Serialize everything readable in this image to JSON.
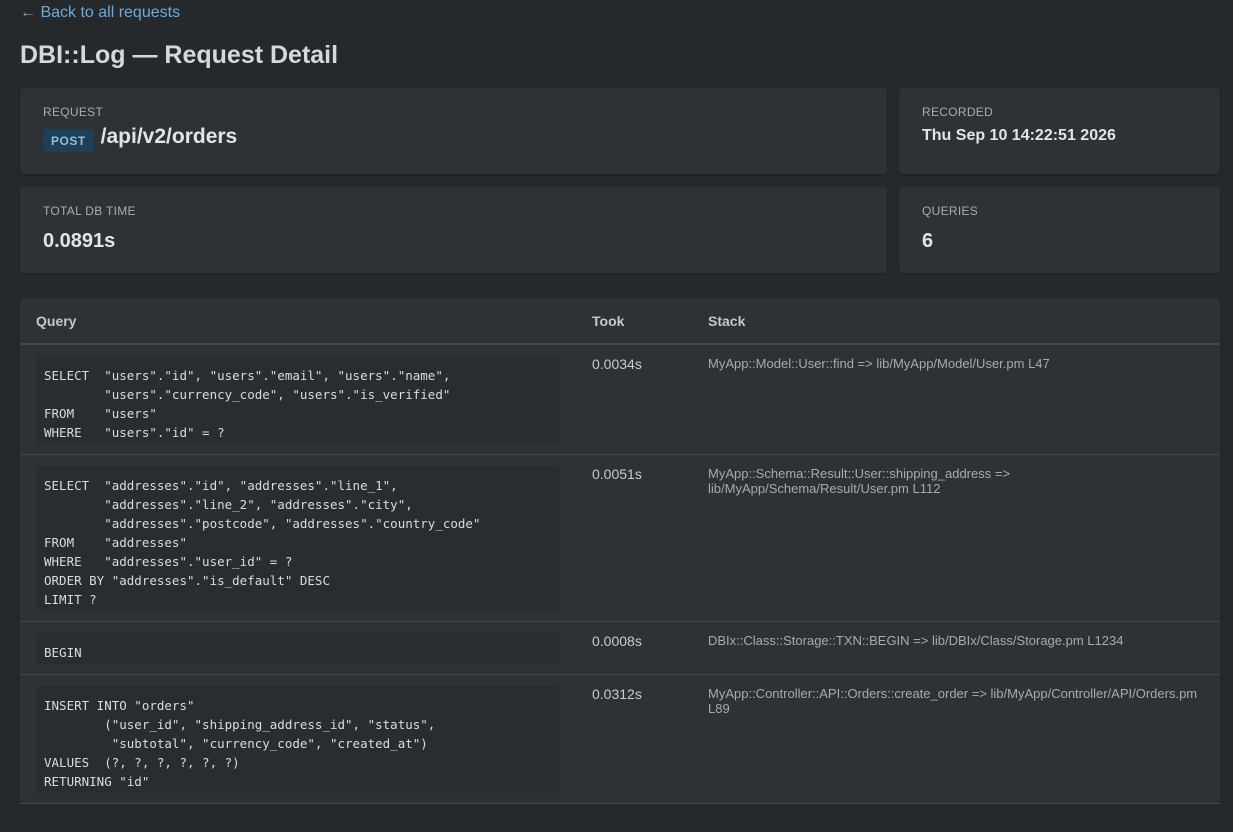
{
  "nav": {
    "back_label": "← Back to all requests"
  },
  "page": {
    "title": "DBI::Log — Request Detail"
  },
  "request_card": {
    "label": "REQUEST",
    "method": "POST",
    "path": "/api/v2/orders"
  },
  "recorded_card": {
    "label": "RECORDED",
    "value": "Thu Sep 10 14:22:51 2026"
  },
  "db_time_card": {
    "label": "TOTAL DB TIME",
    "value": "0.0891s"
  },
  "queries_card": {
    "label": "QUERIES",
    "value": "6"
  },
  "table": {
    "headers": {
      "query": "Query",
      "took": "Took",
      "stack": "Stack"
    },
    "rows": [
      {
        "sql": [
          "SELECT  \"users\".\"id\", \"users\".\"email\", \"users\".\"name\",",
          "        \"users\".\"currency_code\", \"users\".\"is_verified\"",
          "FROM    \"users\"",
          "WHERE   \"users\".\"id\" = ?"
        ],
        "took": "0.0034s",
        "stack": "MyApp::Model::User::find => lib/MyApp/Model/User.pm L47"
      },
      {
        "sql": [
          "SELECT  \"addresses\".\"id\", \"addresses\".\"line_1\",",
          "        \"addresses\".\"line_2\", \"addresses\".\"city\",",
          "        \"addresses\".\"postcode\", \"addresses\".\"country_code\"",
          "FROM    \"addresses\"",
          "WHERE   \"addresses\".\"user_id\" = ?",
          "ORDER BY \"addresses\".\"is_default\" DESC",
          "LIMIT ?"
        ],
        "took": "0.0051s",
        "stack": "MyApp::Schema::Result::User::shipping_address => lib/MyApp/Schema/Result/User.pm L112"
      },
      {
        "sql": [
          "BEGIN"
        ],
        "took": "0.0008s",
        "stack": "DBIx::Class::Storage::TXN::BEGIN => lib/DBIx/Class/Storage.pm L1234"
      },
      {
        "sql": [
          "INSERT INTO \"orders\"",
          "        (\"user_id\", \"shipping_address_id\", \"status\",",
          "         \"subtotal\", \"currency_code\", \"created_at\")",
          "VALUES  (?, ?, ?, ?, ?, ?)",
          "RETURNING \"id\""
        ],
        "took": "0.0312s",
        "stack": "MyApp::Controller::API::Orders::create_order => lib/MyApp/Controller/API/Orders.pm L89"
      }
    ]
  }
}
